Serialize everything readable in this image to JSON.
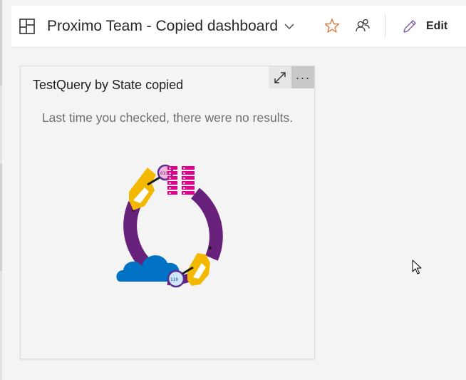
{
  "header": {
    "title": "Proximo Team - Copied dashboard",
    "edit_label": "Edit"
  },
  "icons": {
    "dashboard": "dashboard-grid-icon",
    "dropdown": "chevron-down-icon",
    "favorite": "star-icon",
    "team": "team-members-icon",
    "edit": "pencil-icon",
    "expand": "expand-icon",
    "more": "more-actions-icon",
    "cursor": "mouse-pointer-icon"
  },
  "widget": {
    "title": "TestQuery by State copied",
    "more_label": "···",
    "empty_message": "Last time you checked, there were no results."
  },
  "colors": {
    "accent_star": "#d9773b",
    "edit_pencil": "#7c5ca8",
    "ring_purple": "#68217a",
    "hand_yellow": "#f2b900",
    "server_pink": "#e3008c",
    "cloud_blue": "#0072c6"
  }
}
